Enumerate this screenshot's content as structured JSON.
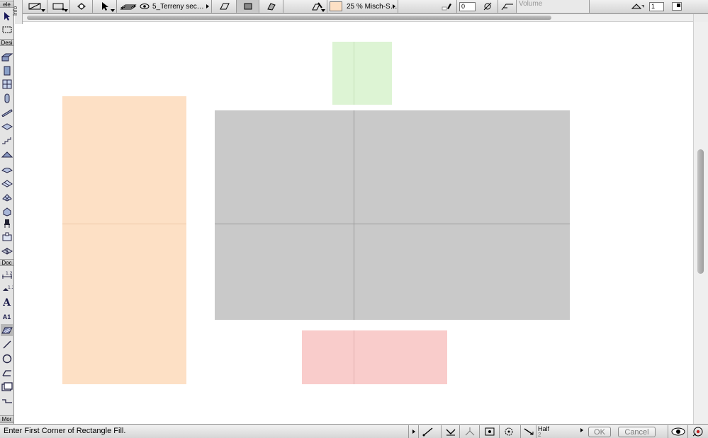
{
  "toolbar": {
    "layer_name": "5_Terreny sec…",
    "fill_name": "25 % Misch-S…",
    "pen_value": "0",
    "surface_label": "Volume",
    "pen_number": "1",
    "fill_color": "#fde0c5"
  },
  "toolbox": {
    "info_tab": "Info",
    "categories": {
      "sele": "ele",
      "design": "Desi",
      "document": "Doc",
      "more": "Mor"
    },
    "text_tool_glyph": "A",
    "label_tool_glyph": "A1"
  },
  "canvas": {
    "fills": [
      {
        "name": "green-fill",
        "color": "#ddf4d4",
        "line": "#c4dfb9"
      },
      {
        "name": "orange-fill",
        "color": "#fde0c5",
        "line": "#ecc8a8"
      },
      {
        "name": "gray-fill",
        "color": "#c9c9c9",
        "line": "#9a9a9a"
      },
      {
        "name": "pink-fill",
        "color": "#f9cccb",
        "line": "#e0b0b0"
      }
    ]
  },
  "statusbar": {
    "prompt": "Enter First Corner of Rectangle Fill.",
    "snap_mode": "Half",
    "snap_value": "2",
    "ok_label": "OK",
    "cancel_label": "Cancel"
  }
}
